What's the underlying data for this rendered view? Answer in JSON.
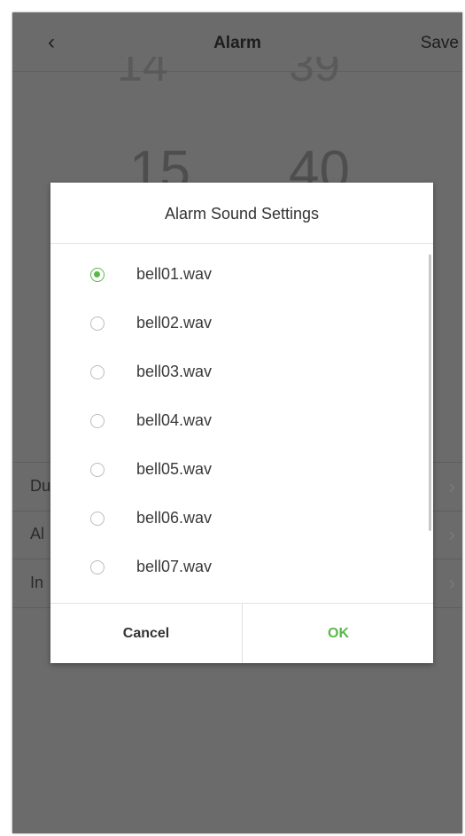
{
  "header": {
    "back_icon": "‹",
    "title": "Alarm",
    "save_label": "Save"
  },
  "time_picker": {
    "hour_prev": "14",
    "hour_current": "15",
    "minute_prev": "39",
    "minute_current": "40"
  },
  "settings_rows": [
    {
      "label": "Du"
    },
    {
      "label": "Al"
    },
    {
      "label": "In"
    }
  ],
  "dialog": {
    "title": "Alarm Sound Settings",
    "options": [
      {
        "label": "bell01.wav",
        "selected": true
      },
      {
        "label": "bell02.wav",
        "selected": false
      },
      {
        "label": "bell03.wav",
        "selected": false
      },
      {
        "label": "bell04.wav",
        "selected": false
      },
      {
        "label": "bell05.wav",
        "selected": false
      },
      {
        "label": "bell06.wav",
        "selected": false
      },
      {
        "label": "bell07.wav",
        "selected": false
      }
    ],
    "cancel_label": "Cancel",
    "ok_label": "OK"
  },
  "colors": {
    "accent": "#5ab84a",
    "overlay": "#6b6b6b"
  }
}
